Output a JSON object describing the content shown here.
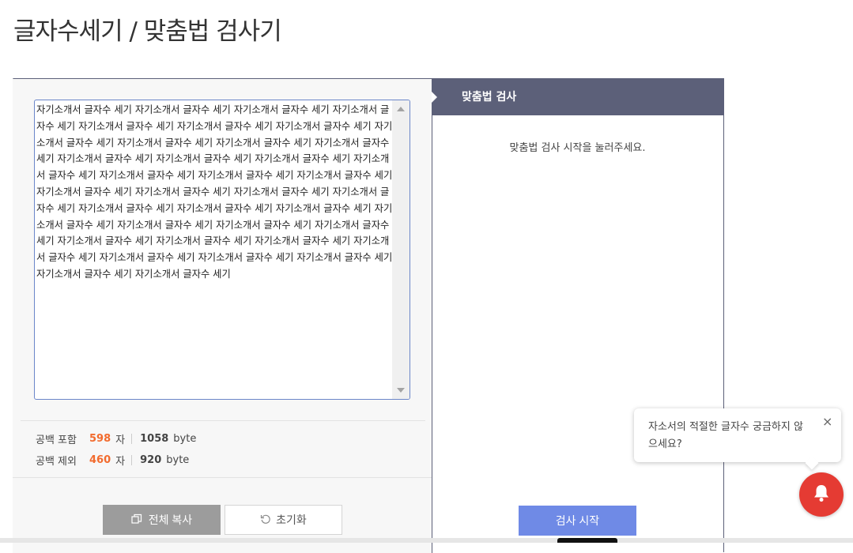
{
  "page": {
    "title": "글자수세기 / 맞춤법 검사기"
  },
  "editor": {
    "text": "자기소개서 글자수 세기 자기소개서 글자수 세기 자기소개서 글자수 세기 자기소개서 글자수 세기 자기소개서 글자수 세기 자기소개서 글자수 세기 자기소개서 글자수 세기 자기소개서 글자수 세기 자기소개서 글자수 세기 자기소개서 글자수 세기 자기소개서 글자수 세기 자기소개서 글자수 세기 자기소개서 글자수 세기 자기소개서 글자수 세기 자기소개서 글자수 세기 자기소개서 글자수 세기 자기소개서 글자수 세기 자기소개서 글자수 세기 자기소개서 글자수 세기 자기소개서 글자수 세기 자기소개서 글자수 세기 자기소개서 글자수 세기 자기소개서 글자수 세기 자기소개서 글자수 세기 자기소개서 글자수 세기 자기소개서 글자수 세기 자기소개서 글자수 세기 자기소개서 글자수 세기 자기소개서 글자수 세기 자기소개서 글자수 세기 자기소개서 글자수 세기 자기소개서 글자수 세기 자기소개서 글자수 세기 자기소개서 글자수 세기 자기소개서 글자수 세기 자기소개서 글자수 세기 자기소개서 글자수 세기 자기소개서 글자수 세기"
  },
  "stats": {
    "with_spaces": {
      "label": "공백 포함",
      "count": "598",
      "unit": "자",
      "bytes": "1058",
      "byte_unit": "byte"
    },
    "without_spaces": {
      "label": "공백 제외",
      "count": "460",
      "unit": "자",
      "bytes": "920",
      "byte_unit": "byte"
    }
  },
  "buttons": {
    "copy_all": "전체 복사",
    "reset": "초기화",
    "check_start": "검사 시작"
  },
  "spellcheck": {
    "header": "맞춤법 검사",
    "message": "맞춤법 검사 시작을 눌러주세요."
  },
  "toast": {
    "message": "자소서의 적절한 글자수 궁금하지 않으세요?",
    "close": "×"
  },
  "colors": {
    "header_bg": "#5c6079",
    "accent_count": "#f26b2e",
    "check_button": "#6f8ae6",
    "bell": "#e53b33"
  },
  "icons": {
    "copy": "copy-icon",
    "reset": "refresh-icon",
    "bell": "bell-icon",
    "close": "close-icon"
  }
}
